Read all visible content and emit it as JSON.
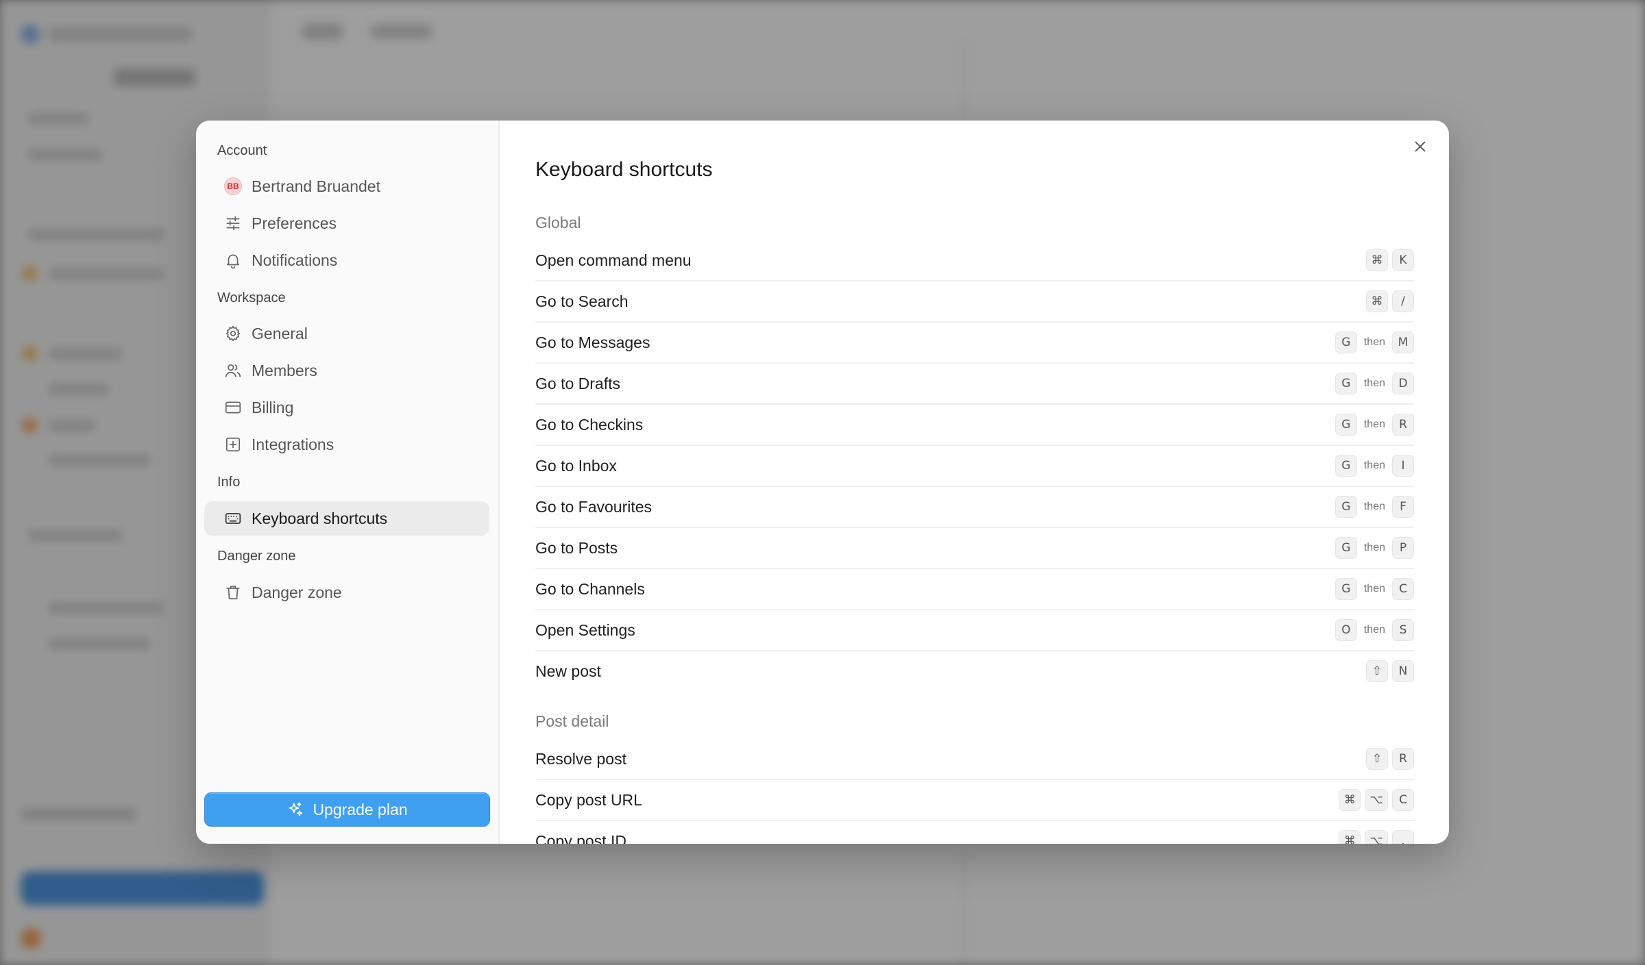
{
  "modal": {
    "sidebar": {
      "sections": [
        {
          "label": "Account",
          "items": [
            {
              "label": "Bertrand Bruandet",
              "icon": "avatar",
              "avatar_initials": "BB"
            },
            {
              "label": "Preferences",
              "icon": "sliders-icon"
            },
            {
              "label": "Notifications",
              "icon": "bell-icon"
            }
          ]
        },
        {
          "label": "Workspace",
          "items": [
            {
              "label": "General",
              "icon": "gear-icon"
            },
            {
              "label": "Members",
              "icon": "users-icon"
            },
            {
              "label": "Billing",
              "icon": "credit-card-icon"
            },
            {
              "label": "Integrations",
              "icon": "plus-square-icon"
            }
          ]
        },
        {
          "label": "Info",
          "items": [
            {
              "label": "Keyboard shortcuts",
              "icon": "keyboard-icon",
              "active": true
            }
          ]
        },
        {
          "label": "Danger zone",
          "items": [
            {
              "label": "Danger zone",
              "icon": "trash-icon"
            }
          ]
        }
      ],
      "upgrade_label": "Upgrade plan",
      "upgrade_color": "#3f9ff0"
    },
    "main": {
      "title": "Keyboard shortcuts",
      "groups": [
        {
          "title": "Global",
          "shortcuts": [
            {
              "label": "Open command menu",
              "keys": [
                "⌘",
                "K"
              ]
            },
            {
              "label": "Go to Search",
              "keys": [
                "⌘",
                "/"
              ]
            },
            {
              "label": "Go to Messages",
              "keys": [
                "G",
                "then",
                "M"
              ]
            },
            {
              "label": "Go to Drafts",
              "keys": [
                "G",
                "then",
                "D"
              ]
            },
            {
              "label": "Go to Checkins",
              "keys": [
                "G",
                "then",
                "R"
              ]
            },
            {
              "label": "Go to Inbox",
              "keys": [
                "G",
                "then",
                "I"
              ]
            },
            {
              "label": "Go to Favourites",
              "keys": [
                "G",
                "then",
                "F"
              ]
            },
            {
              "label": "Go to Posts",
              "keys": [
                "G",
                "then",
                "P"
              ]
            },
            {
              "label": "Go to Channels",
              "keys": [
                "G",
                "then",
                "C"
              ]
            },
            {
              "label": "Open Settings",
              "keys": [
                "O",
                "then",
                "S"
              ]
            },
            {
              "label": "New post",
              "keys": [
                "⇧",
                "N"
              ]
            }
          ]
        },
        {
          "title": "Post detail",
          "shortcuts": [
            {
              "label": "Resolve post",
              "keys": [
                "⇧",
                "R"
              ]
            },
            {
              "label": "Copy post URL",
              "keys": [
                "⌘",
                "⌥",
                "C"
              ]
            },
            {
              "label": "Copy post ID",
              "keys": [
                "⌘",
                "⌥",
                "."
              ]
            }
          ]
        }
      ]
    }
  }
}
